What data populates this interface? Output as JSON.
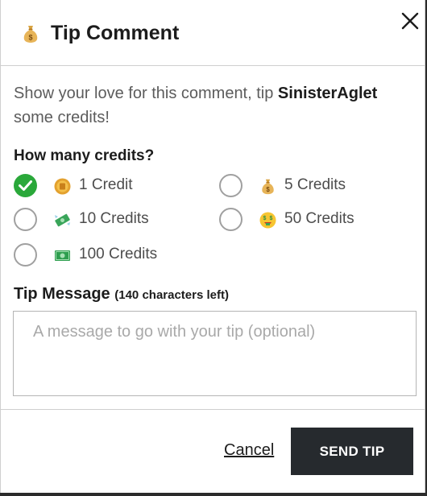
{
  "colors": {
    "selected": "#2aa83a",
    "send_button": "#262a2e",
    "intro_text": "#5c5c5c"
  },
  "header": {
    "title": "Tip Comment",
    "icon": "money-bag-icon",
    "close_icon": "close-icon"
  },
  "intro": {
    "before": "Show your love for this comment, tip ",
    "username": "SinisterAglet",
    "after": " some credits!"
  },
  "credits": {
    "label": "How many credits?",
    "selected_index": 0,
    "options": [
      {
        "label": "1 Credit",
        "icon": "coin-icon"
      },
      {
        "label": "5 Credits",
        "icon": "money-bag-icon"
      },
      {
        "label": "10 Credits",
        "icon": "money-with-wings-icon"
      },
      {
        "label": "50 Credits",
        "icon": "money-mouth-face-icon"
      },
      {
        "label": "100 Credits",
        "icon": "dollar-banknote-icon"
      }
    ]
  },
  "message": {
    "label": "Tip Message",
    "chars_left": "(140 characters left)",
    "placeholder": "A message to go with your tip (optional)",
    "value": ""
  },
  "footer": {
    "cancel_label": "Cancel",
    "send_label": "SEND TIP"
  }
}
